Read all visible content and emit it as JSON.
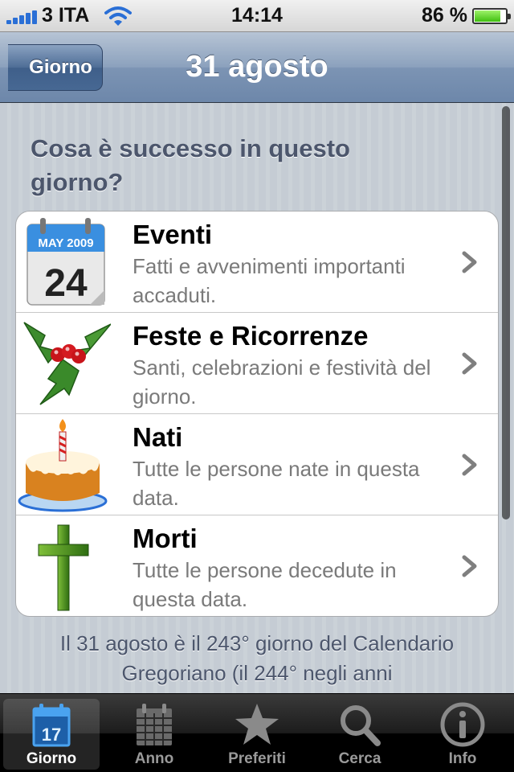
{
  "status_bar": {
    "carrier": "3 ITA",
    "time": "14:14",
    "battery_percent": "86 %",
    "battery_level": 0.86
  },
  "nav": {
    "back_label": "Giorno",
    "title": "31 agosto"
  },
  "section_header": "Cosa è successo in questo giorno?",
  "rows": [
    {
      "title": "Eventi",
      "subtitle": "Fatti e avvenimenti importanti accaduti.",
      "icon": "calendar-icon",
      "calendar_month": "MAY 2009",
      "calendar_day": "24"
    },
    {
      "title": "Feste e Ricorrenze",
      "subtitle": "Santi, celebrazioni e festività del giorno.",
      "icon": "holly-icon"
    },
    {
      "title": "Nati",
      "subtitle": "Tutte le persone nate in questa data.",
      "icon": "birthday-cake-icon"
    },
    {
      "title": "Morti",
      "subtitle": "Tutte le persone decedute in questa data.",
      "icon": "cross-icon"
    }
  ],
  "footer_text": "Il 31 agosto è il 243° giorno del Calendario Gregoriano (il 244° negli anni",
  "tabs": [
    {
      "label": "Giorno",
      "icon": "calendar-day-icon",
      "icon_text": "17",
      "selected": true
    },
    {
      "label": "Anno",
      "icon": "calendar-grid-icon",
      "selected": false
    },
    {
      "label": "Preferiti",
      "icon": "star-icon",
      "selected": false
    },
    {
      "label": "Cerca",
      "icon": "search-icon",
      "selected": false
    },
    {
      "label": "Info",
      "icon": "info-icon",
      "selected": false
    }
  ],
  "colors": {
    "nav_tint": "#6d87aa",
    "tab_active_icon": "#4aa3f0",
    "section_text": "#4c566c"
  }
}
